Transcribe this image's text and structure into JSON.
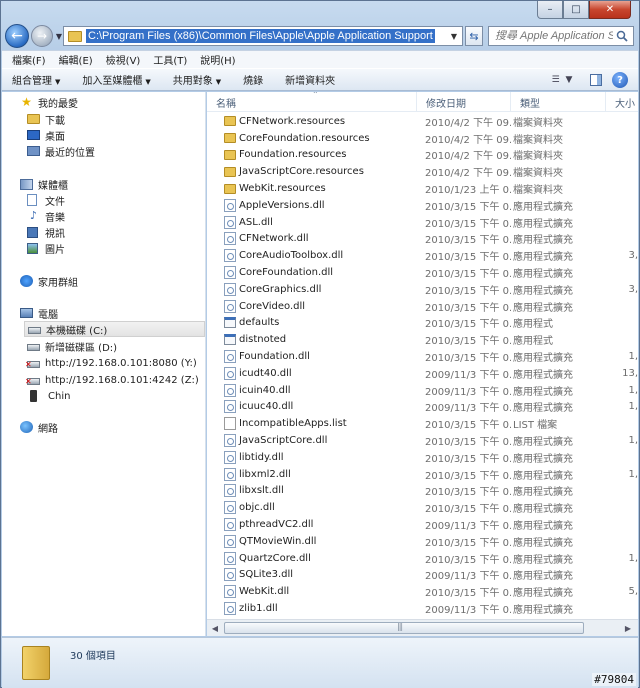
{
  "window": {
    "caption_buttons": [
      "–",
      "□",
      "✕"
    ]
  },
  "address_bar": {
    "path": "C:\\Program Files (x86)\\Common Files\\Apple\\Apple Application Support",
    "search_placeholder": "搜尋 Apple Application Sup..."
  },
  "menu": {
    "items": [
      "檔案(F)",
      "編輯(E)",
      "檢視(V)",
      "工具(T)",
      "說明(H)"
    ]
  },
  "commands": {
    "organize": "組合管理",
    "add_to_library": "加入至媒體櫃",
    "share_with": "共用對象",
    "burn": "燒錄",
    "new_folder": "新增資料夾"
  },
  "nav_pane": {
    "favorites": {
      "label": "我的最愛",
      "items": [
        "下載",
        "桌面",
        "最近的位置"
      ]
    },
    "libraries": {
      "label": "媒體櫃",
      "items": [
        "文件",
        "音樂",
        "視訊",
        "圖片"
      ]
    },
    "homegroup": "家用群組",
    "computer": {
      "label": "電腦",
      "items": [
        "本機磁碟 (C:)",
        "新增磁碟區 (D:)",
        "http://192.168.0.101:8080 (Y:)",
        "http://192.168.0.101:4242 (Z:)",
        "Chin"
      ]
    },
    "network": "網路"
  },
  "columns": {
    "name": "名稱",
    "date": "修改日期",
    "type": "類型",
    "size": "大小"
  },
  "files": [
    {
      "name": "CFNetwork.resources",
      "date": "2010/4/2 下午 09...",
      "type": "檔案資料夾",
      "size": "",
      "kind": "folder"
    },
    {
      "name": "CoreFoundation.resources",
      "date": "2010/4/2 下午 09...",
      "type": "檔案資料夾",
      "size": "",
      "kind": "folder"
    },
    {
      "name": "Foundation.resources",
      "date": "2010/4/2 下午 09...",
      "type": "檔案資料夾",
      "size": "",
      "kind": "folder"
    },
    {
      "name": "JavaScriptCore.resources",
      "date": "2010/4/2 下午 09...",
      "type": "檔案資料夾",
      "size": "",
      "kind": "folder"
    },
    {
      "name": "WebKit.resources",
      "date": "2010/1/23 上午 0...",
      "type": "檔案資料夾",
      "size": "",
      "kind": "folder"
    },
    {
      "name": "AppleVersions.dll",
      "date": "2010/3/15 下午 0...",
      "type": "應用程式擴充",
      "size": "",
      "kind": "dll"
    },
    {
      "name": "ASL.dll",
      "date": "2010/3/15 下午 0...",
      "type": "應用程式擴充",
      "size": "",
      "kind": "dll"
    },
    {
      "name": "CFNetwork.dll",
      "date": "2010/3/15 下午 0...",
      "type": "應用程式擴充",
      "size": "",
      "kind": "dll"
    },
    {
      "name": "CoreAudioToolbox.dll",
      "date": "2010/3/15 下午 0...",
      "type": "應用程式擴充",
      "size": "3,",
      "kind": "dll"
    },
    {
      "name": "CoreFoundation.dll",
      "date": "2010/3/15 下午 0...",
      "type": "應用程式擴充",
      "size": "",
      "kind": "dll"
    },
    {
      "name": "CoreGraphics.dll",
      "date": "2010/3/15 下午 0...",
      "type": "應用程式擴充",
      "size": "3,",
      "kind": "dll"
    },
    {
      "name": "CoreVideo.dll",
      "date": "2010/3/15 下午 0...",
      "type": "應用程式擴充",
      "size": "",
      "kind": "dll"
    },
    {
      "name": "defaults",
      "date": "2010/3/15 下午 0...",
      "type": "應用程式",
      "size": "",
      "kind": "exe"
    },
    {
      "name": "distnoted",
      "date": "2010/3/15 下午 0...",
      "type": "應用程式",
      "size": "",
      "kind": "exe"
    },
    {
      "name": "Foundation.dll",
      "date": "2010/3/15 下午 0...",
      "type": "應用程式擴充",
      "size": "1,",
      "kind": "dll"
    },
    {
      "name": "icudt40.dll",
      "date": "2009/11/3 下午 0...",
      "type": "應用程式擴充",
      "size": "13,",
      "kind": "dll"
    },
    {
      "name": "icuin40.dll",
      "date": "2009/11/3 下午 0...",
      "type": "應用程式擴充",
      "size": "1,",
      "kind": "dll"
    },
    {
      "name": "icuuc40.dll",
      "date": "2009/11/3 下午 0...",
      "type": "應用程式擴充",
      "size": "1,",
      "kind": "dll"
    },
    {
      "name": "IncompatibleApps.list",
      "date": "2010/3/15 下午 0...",
      "type": "LIST 檔案",
      "size": "",
      "kind": "doc"
    },
    {
      "name": "JavaScriptCore.dll",
      "date": "2010/3/15 下午 0...",
      "type": "應用程式擴充",
      "size": "1,",
      "kind": "dll"
    },
    {
      "name": "libtidy.dll",
      "date": "2010/3/15 下午 0...",
      "type": "應用程式擴充",
      "size": "",
      "kind": "dll"
    },
    {
      "name": "libxml2.dll",
      "date": "2010/3/15 下午 0...",
      "type": "應用程式擴充",
      "size": "1,",
      "kind": "dll"
    },
    {
      "name": "libxslt.dll",
      "date": "2010/3/15 下午 0...",
      "type": "應用程式擴充",
      "size": "",
      "kind": "dll"
    },
    {
      "name": "objc.dll",
      "date": "2010/3/15 下午 0...",
      "type": "應用程式擴充",
      "size": "",
      "kind": "dll"
    },
    {
      "name": "pthreadVC2.dll",
      "date": "2009/11/3 下午 0...",
      "type": "應用程式擴充",
      "size": "",
      "kind": "dll"
    },
    {
      "name": "QTMovieWin.dll",
      "date": "2010/3/15 下午 0...",
      "type": "應用程式擴充",
      "size": "",
      "kind": "dll"
    },
    {
      "name": "QuartzCore.dll",
      "date": "2010/3/15 下午 0...",
      "type": "應用程式擴充",
      "size": "1,",
      "kind": "dll"
    },
    {
      "name": "SQLite3.dll",
      "date": "2009/11/3 下午 0...",
      "type": "應用程式擴充",
      "size": "",
      "kind": "dll"
    },
    {
      "name": "WebKit.dll",
      "date": "2010/3/15 下午 0...",
      "type": "應用程式擴充",
      "size": "5,",
      "kind": "dll"
    },
    {
      "name": "zlib1.dll",
      "date": "2009/11/3 下午 0...",
      "type": "應用程式擴充",
      "size": "",
      "kind": "dll"
    }
  ],
  "details": {
    "item_count": "30 個項目"
  },
  "watermark": "#79804"
}
